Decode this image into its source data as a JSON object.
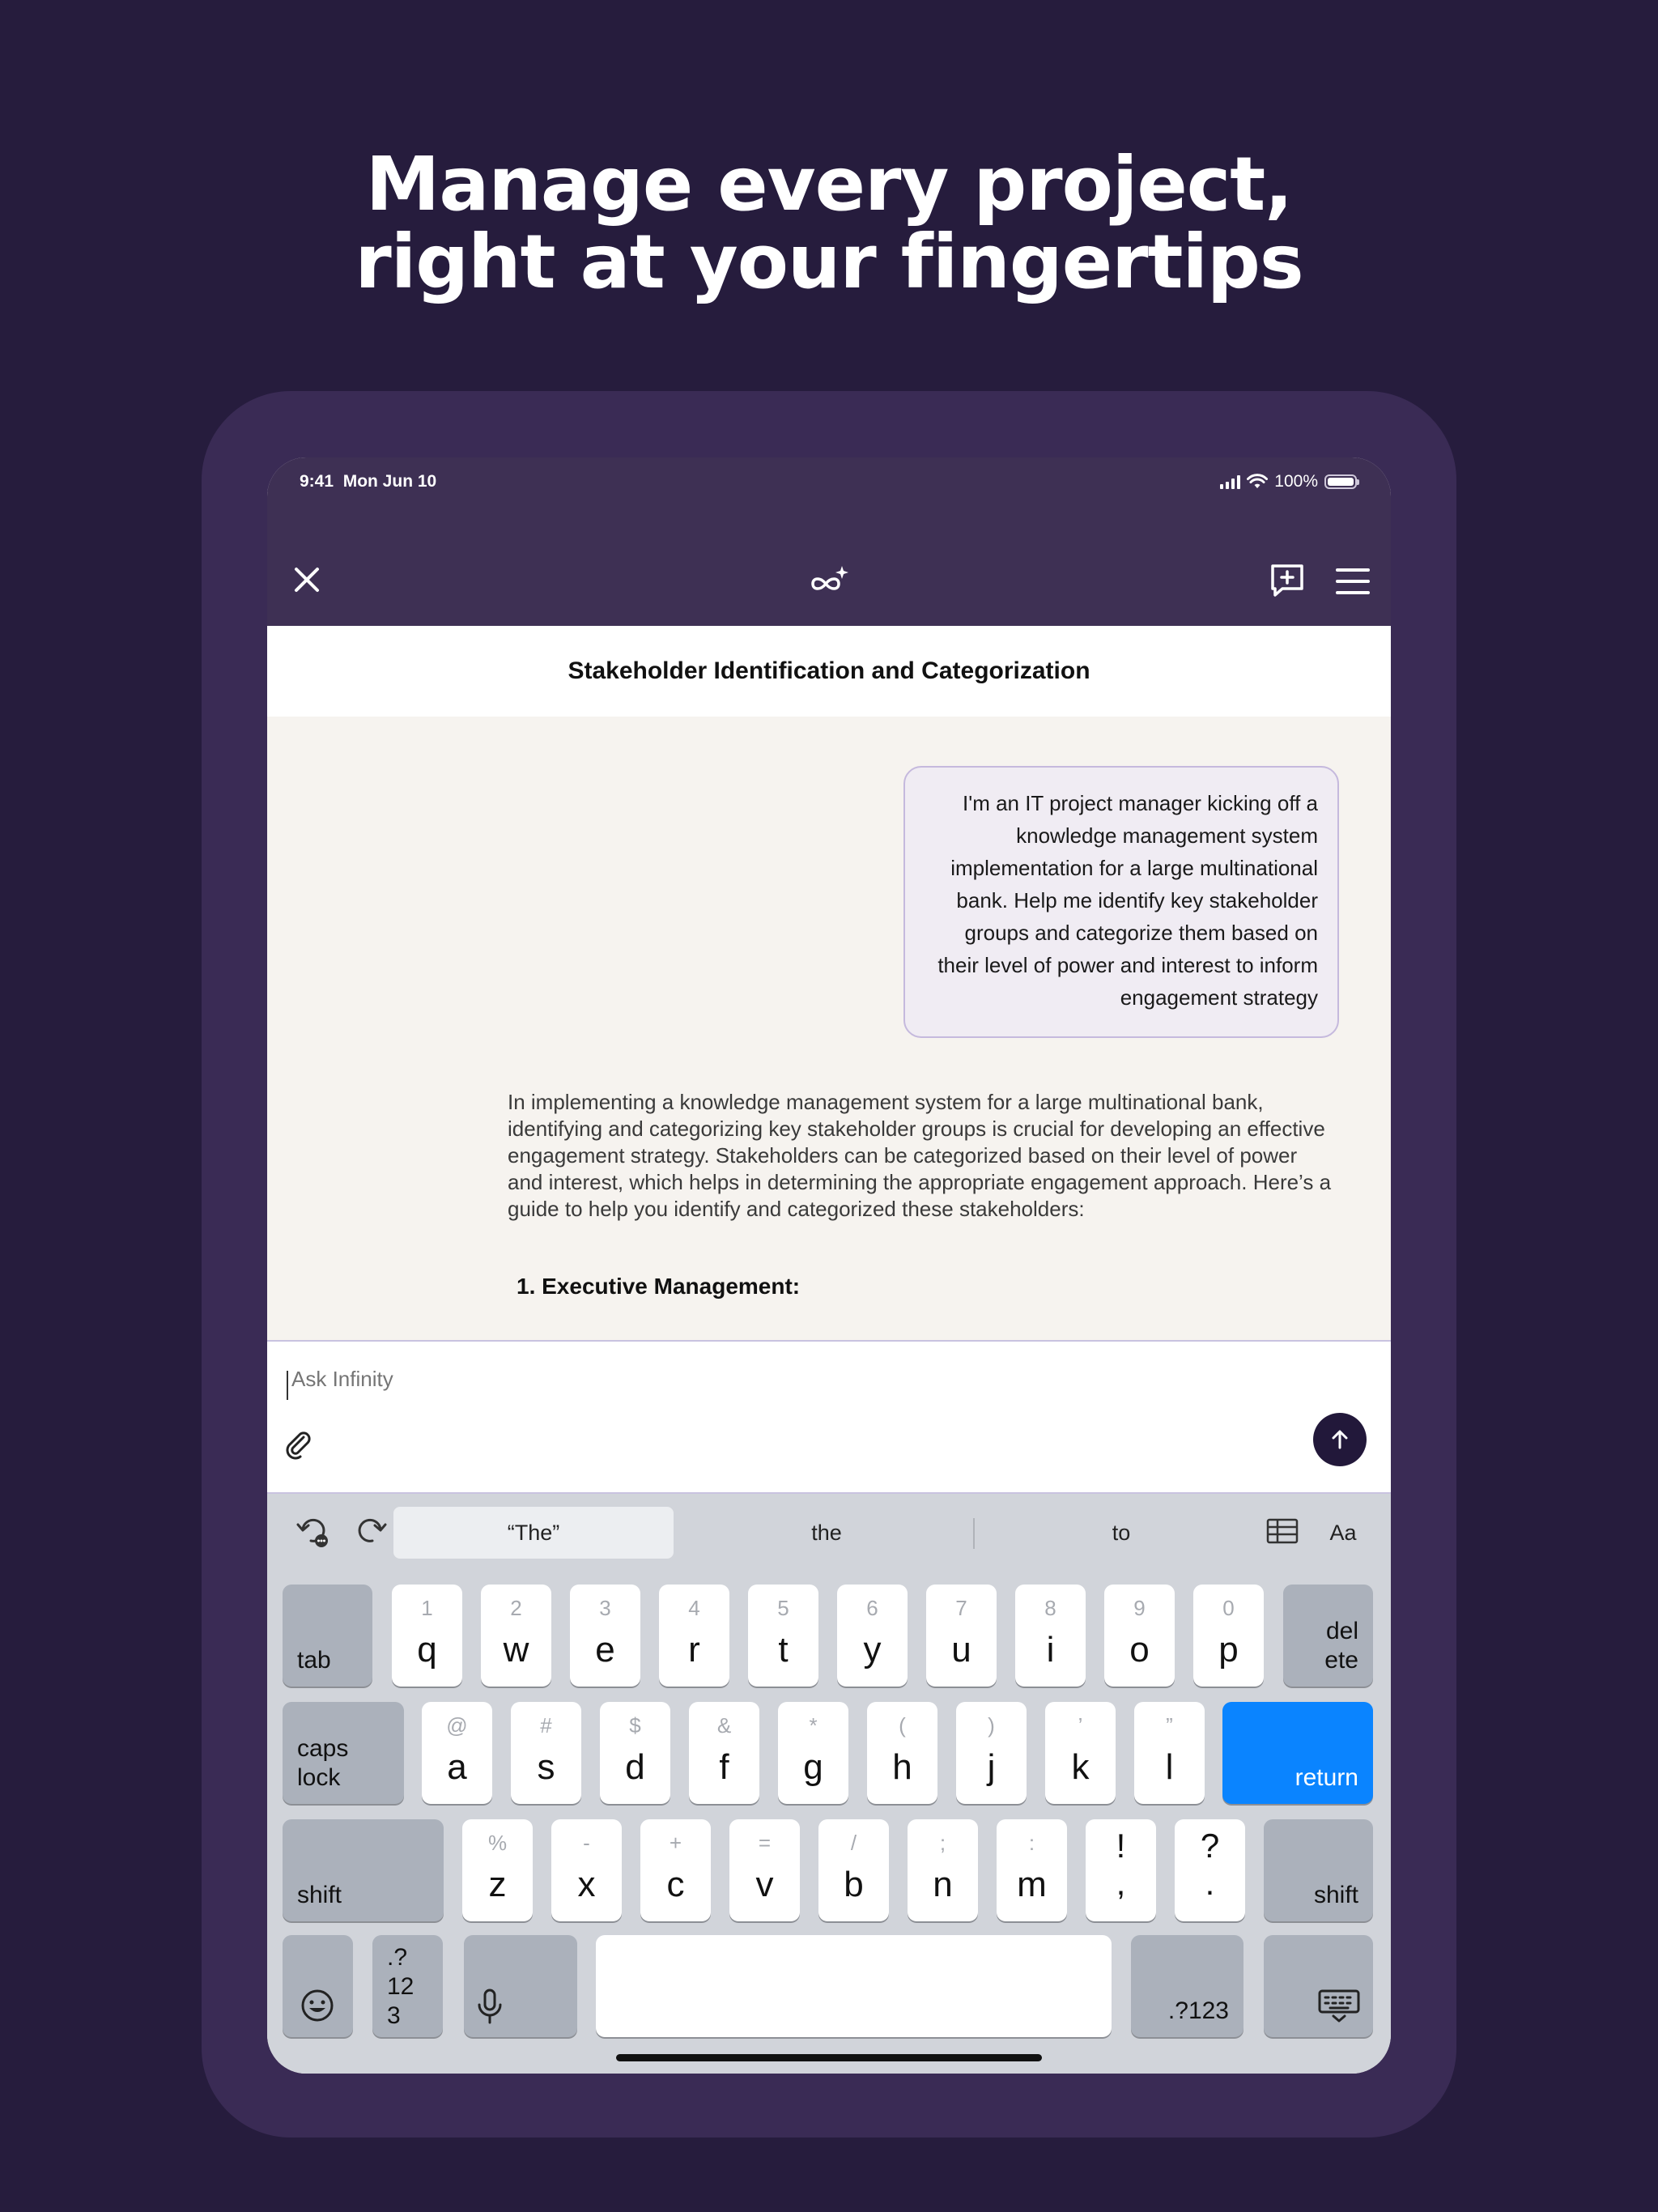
{
  "marketing": {
    "headline_line1": "Manage every project,",
    "headline_line2": "right at your fingertips"
  },
  "status_bar": {
    "time": "9:41",
    "date": "Mon Jun 10",
    "battery": "100%"
  },
  "toolbar": {
    "close_icon": "close-icon",
    "logo_icon": "infinity-sparkle-icon",
    "new_chat_icon": "new-chat-icon",
    "menu_icon": "hamburger-menu-icon"
  },
  "chat": {
    "title": "Stakeholder Identification and Categorization",
    "user_message": [
      "I'm an IT project manager kicking off a",
      "knowledge management system",
      "implementation for a large multinational",
      "bank. Help me identify key stakeholder",
      "groups and categorize them based on",
      "their level of power and interest to inform",
      "engagement strategy"
    ],
    "assistant_message": "In implementing a knowledge management system for a large multinational bank, identifying and categorizing key stakeholder groups is crucial for developing an effective engagement strategy. Stakeholders can be categorized based on their level of power and interest, which helps in determining the appropriate engagement approach. Here’s a guide to help you identify and categorized these stakeholders:",
    "assistant_heading": "1. Executive Management:"
  },
  "composer": {
    "value": "",
    "placeholder": "Ask Infinity"
  },
  "keyboard": {
    "suggestions": [
      "“The”",
      "the",
      "to"
    ],
    "format_label": "Aa",
    "row1": [
      {
        "sec": "1",
        "pri": "q"
      },
      {
        "sec": "2",
        "pri": "w"
      },
      {
        "sec": "3",
        "pri": "e"
      },
      {
        "sec": "4",
        "pri": "r"
      },
      {
        "sec": "5",
        "pri": "t"
      },
      {
        "sec": "6",
        "pri": "y"
      },
      {
        "sec": "7",
        "pri": "u"
      },
      {
        "sec": "8",
        "pri": "i"
      },
      {
        "sec": "9",
        "pri": "o"
      },
      {
        "sec": "0",
        "pri": "p"
      }
    ],
    "row2": [
      {
        "sec": "@",
        "pri": "a"
      },
      {
        "sec": "#",
        "pri": "s"
      },
      {
        "sec": "$",
        "pri": "d"
      },
      {
        "sec": "&",
        "pri": "f"
      },
      {
        "sec": "*",
        "pri": "g"
      },
      {
        "sec": "(",
        "pri": "h"
      },
      {
        "sec": ")",
        "pri": "j"
      },
      {
        "sec": "’",
        "pri": "k"
      },
      {
        "sec": "”",
        "pri": "l"
      }
    ],
    "row3": [
      {
        "sec": "%",
        "pri": "z"
      },
      {
        "sec": "-",
        "pri": "x"
      },
      {
        "sec": "+",
        "pri": "c"
      },
      {
        "sec": "=",
        "pri": "v"
      },
      {
        "sec": "/",
        "pri": "b"
      },
      {
        "sec": ";",
        "pri": "n"
      },
      {
        "sec": ":",
        "pri": "m"
      }
    ],
    "punct1": {
      "top": "!",
      "bottom": ","
    },
    "punct2": {
      "top": "?",
      "bottom": "."
    },
    "tab": "tab",
    "delete_line1": "del",
    "delete_line2": "ete",
    "caps_line1": "caps",
    "caps_line2": "lock",
    "return": "return",
    "shift": "shift",
    "numbers_line1": ".?",
    "numbers_line2": "12",
    "numbers_line3": "3",
    "numbers_right": ".?123"
  }
}
